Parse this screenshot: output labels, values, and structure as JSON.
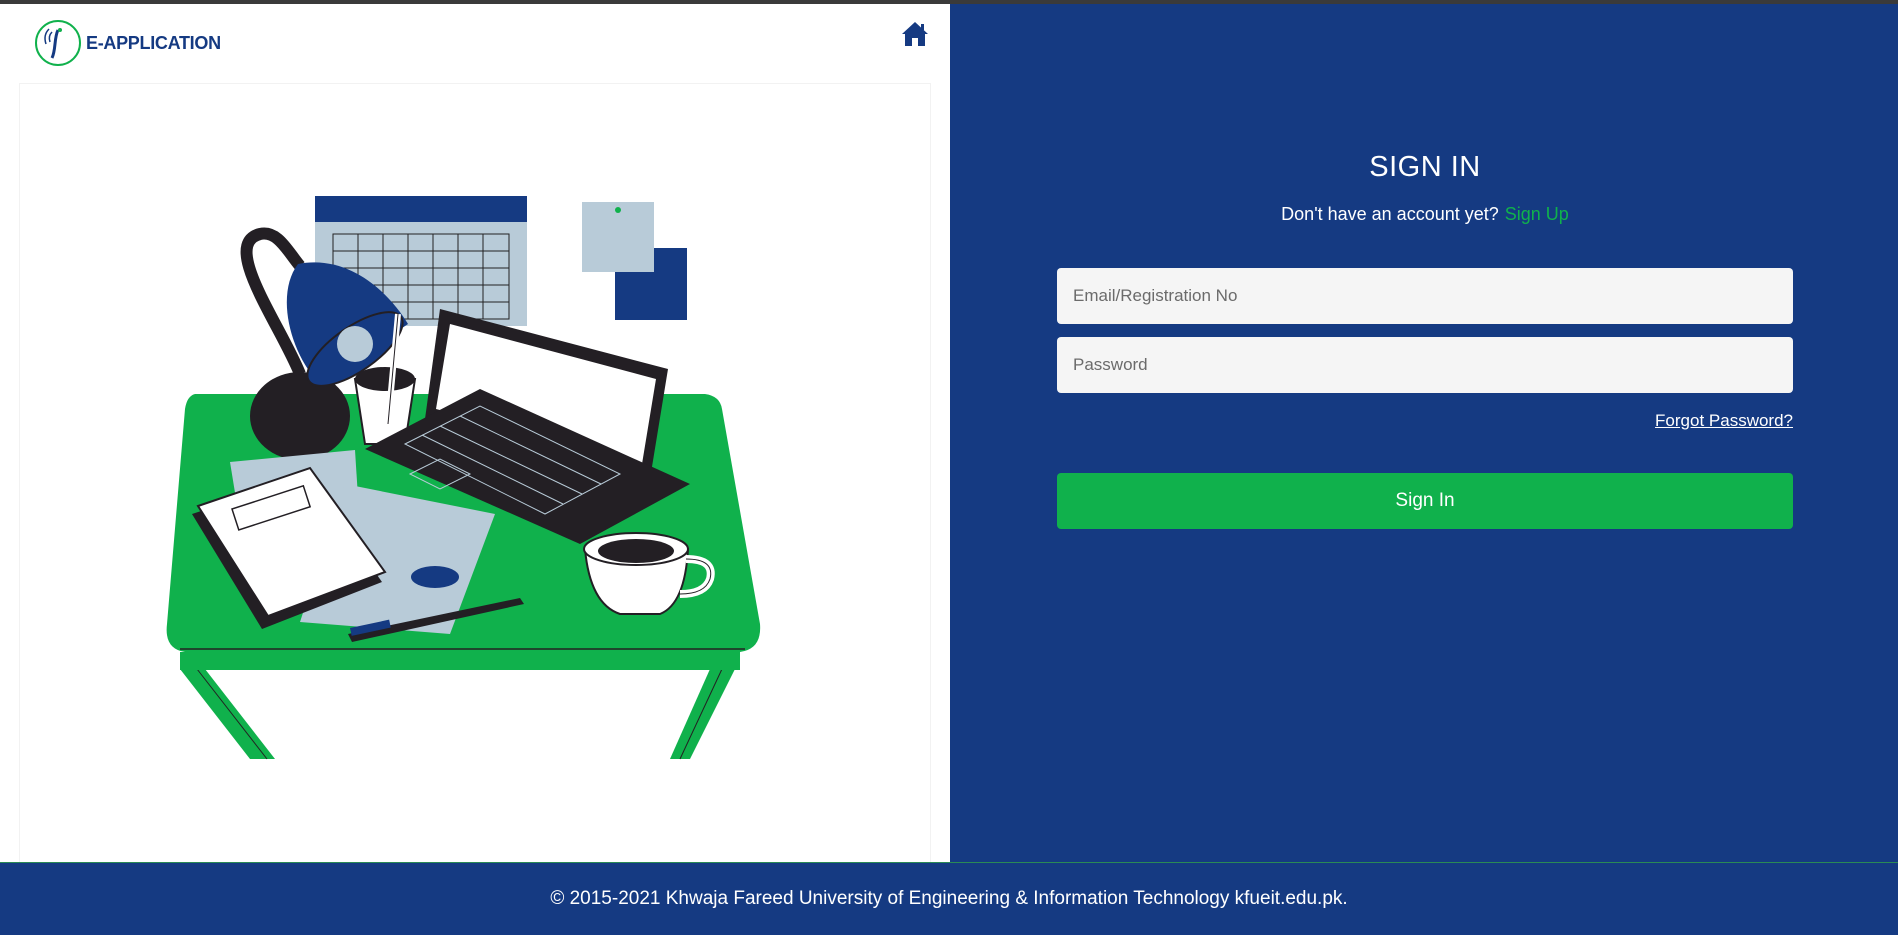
{
  "header": {
    "logo_text": "E-APPLICATION",
    "logo_icon": "university-logo-icon",
    "home_icon": "home-icon"
  },
  "illustration": {
    "icon": "desk-workspace-illustration"
  },
  "signin": {
    "title": "SIGN IN",
    "prompt": "Don't have an account yet?",
    "signup_link": "Sign Up",
    "email_placeholder": "Email/Registration No",
    "email_value": "",
    "password_placeholder": "Password",
    "password_value": "",
    "forgot_link": "Forgot Password?",
    "submit_label": "Sign In"
  },
  "footer": {
    "copyright": "© 2015-2021 Khwaja Fareed University of Engineering & Information Technology kfueit.edu.pk."
  },
  "colors": {
    "brand_blue": "#153a82",
    "accent_green": "#10b14c",
    "input_bg": "#f5f5f5"
  }
}
